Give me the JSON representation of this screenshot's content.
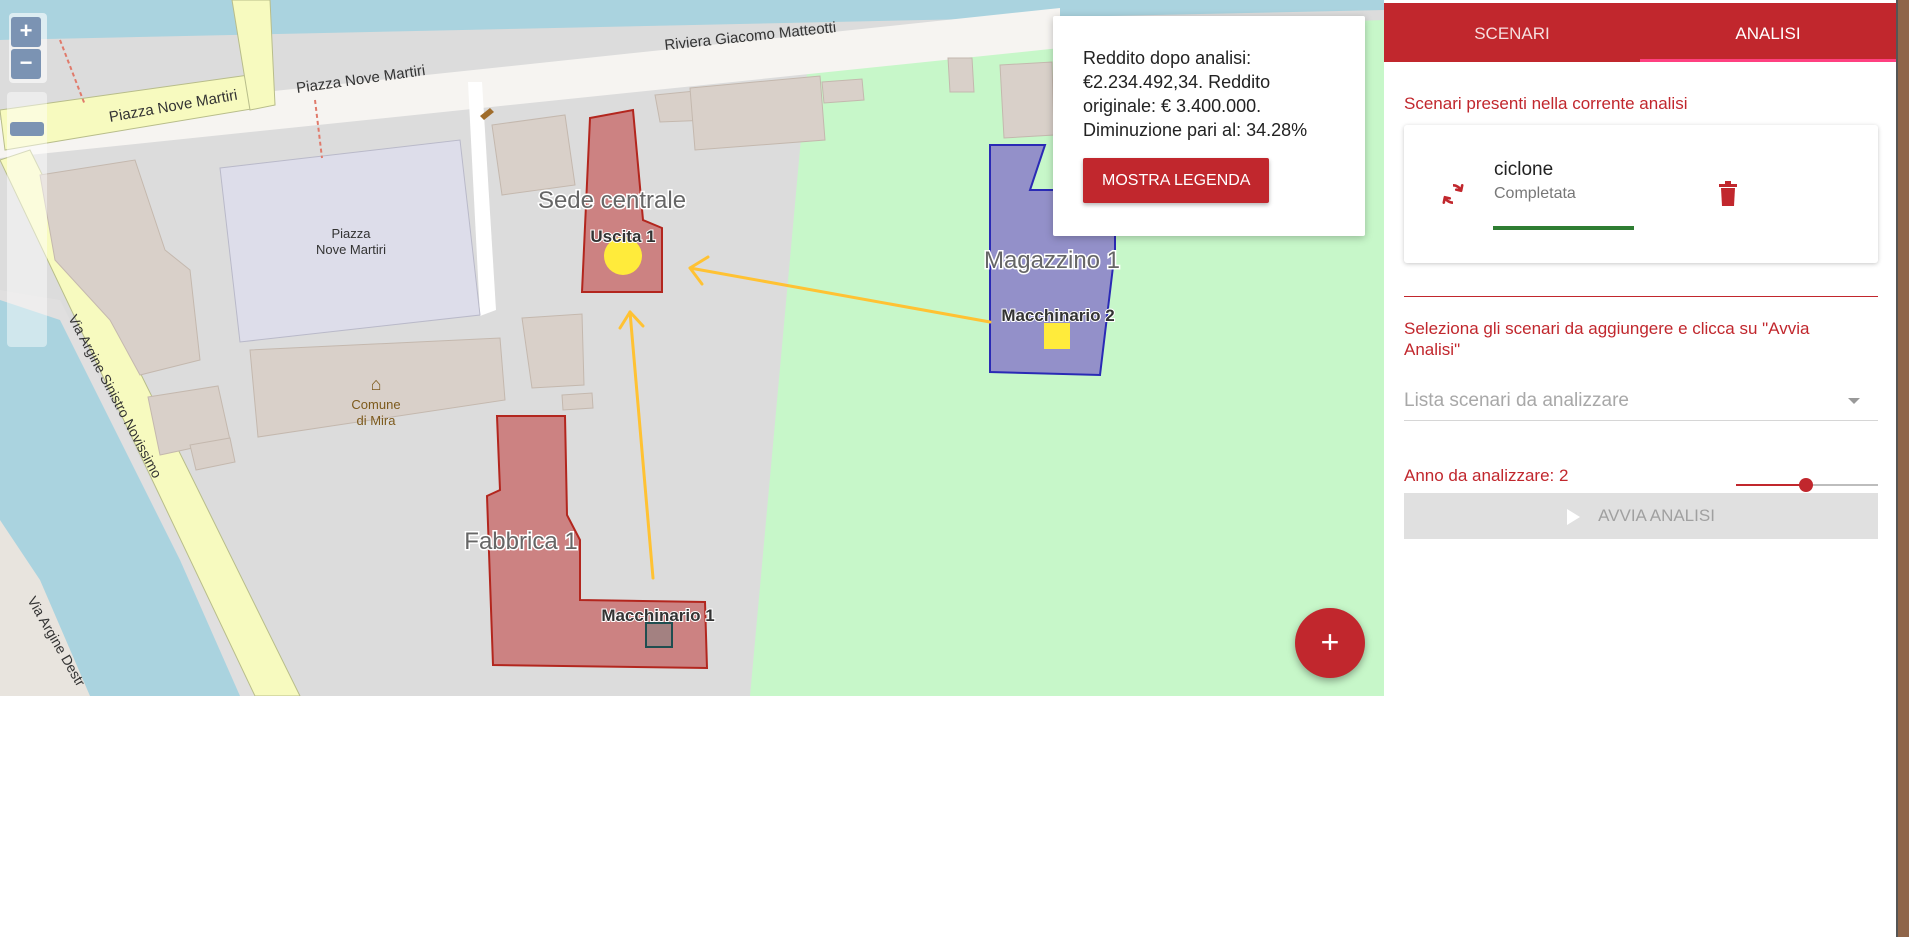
{
  "map": {
    "streets": {
      "piazza_nove_martiri_a": "Piazza Nove Martiri",
      "piazza_nove_martiri_b": "Piazza Nove Martiri",
      "riviera": "Riviera Giacomo Matteotti",
      "via_argine_sinistro": "Via Argine Sinistro Novissimo",
      "via_argine_destro": "Via Argine Destr"
    },
    "places": {
      "piazza_line1": "Piazza",
      "piazza_line2": "Nove Martiri",
      "comune_line1": "Comune",
      "comune_line2": "di Mira"
    },
    "labels": {
      "sede_centrale": "Sede centrale",
      "uscita_1": "Uscita 1",
      "magazzino_1": "Magazzino 1",
      "macchinario_2": "Macchinario 2",
      "fabbrica_1": "Fabbrica 1",
      "macchinario_1": "Macchinario 1"
    },
    "zoom": {
      "in": "+",
      "out": "−"
    },
    "fab": "+"
  },
  "info": {
    "text_line1": "Reddito dopo analisi:",
    "text_line2": "€2.234.492,34. Reddito",
    "text_line3": "originale: € 3.400.000.",
    "text_line4": "Diminuzione pari al: 34.28%",
    "legend_button": "MOSTRA LEGENDA"
  },
  "panel": {
    "tabs": [
      {
        "label": "SCENARI",
        "active": false
      },
      {
        "label": "ANALISI",
        "active": true
      }
    ],
    "scenari_label": "Scenari presenti nella corrente analisi",
    "scenario": {
      "name": "ciclone",
      "status": "Completata",
      "progress": 1.0,
      "progress_color": "#2e7d32",
      "refresh_icon": "refresh-icon",
      "delete_icon": "trash-icon"
    },
    "select_instruction": "Seleziona gli scenari da aggiungere e clicca su \"Avvia Analisi\"",
    "select_placeholder": "Lista scenari da analizzare",
    "anno_label": "Anno da analizzare: 2",
    "anno_value": 2,
    "run_button": "AVVIA ANALISI"
  },
  "colors": {
    "accent": "#c1272d",
    "building_red": "#c77c7c",
    "building_blue": "#9a8fc9",
    "arrow": "#ffc233",
    "park": "#c7f7c9",
    "water": "#aad3df"
  }
}
